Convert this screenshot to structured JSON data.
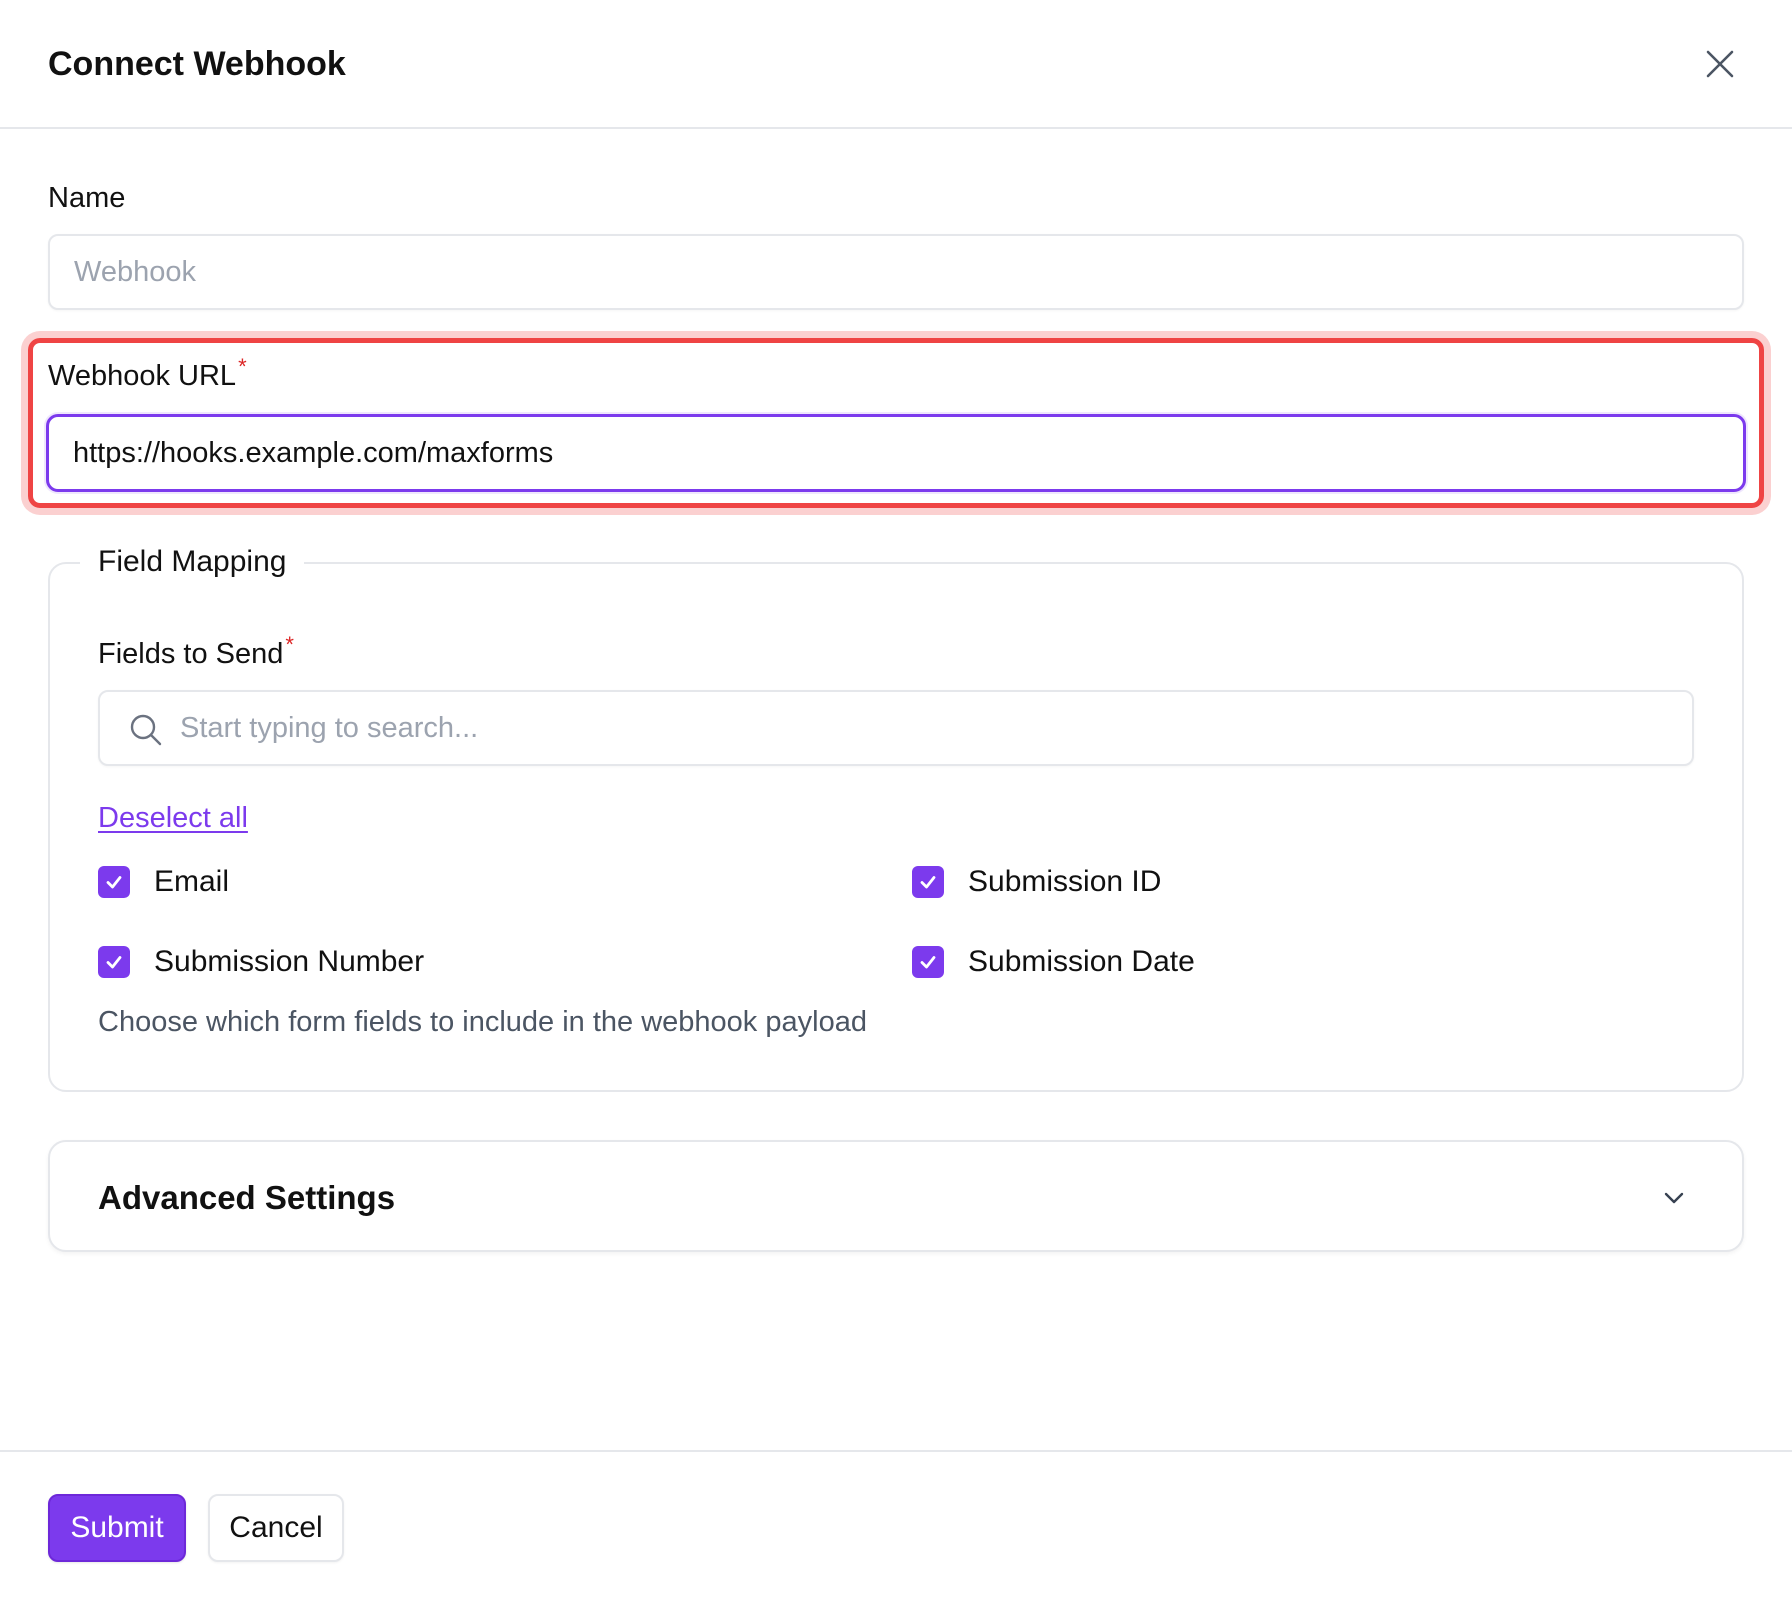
{
  "modal": {
    "title": "Connect Webhook"
  },
  "name_field": {
    "label": "Name",
    "placeholder": "Webhook",
    "value": ""
  },
  "url_field": {
    "label": "Webhook URL",
    "required_mark": "*",
    "value": "https://hooks.example.com/maxforms"
  },
  "field_mapping": {
    "legend": "Field Mapping",
    "fields_label": "Fields to Send",
    "required_mark": "*",
    "search_placeholder": "Start typing to search...",
    "deselect_all_label": "Deselect all",
    "options": [
      {
        "label": "Email",
        "checked": true
      },
      {
        "label": "Submission ID",
        "checked": true
      },
      {
        "label": "Submission Number",
        "checked": true
      },
      {
        "label": "Submission Date",
        "checked": true
      }
    ],
    "helper_text": "Choose which form fields to include in the webhook payload"
  },
  "advanced": {
    "title": "Advanced Settings",
    "expanded": false
  },
  "footer": {
    "submit_label": "Submit",
    "cancel_label": "Cancel"
  },
  "colors": {
    "accent": "#7c3aed",
    "highlight": "#ef4444",
    "required": "#dc2626",
    "border": "#e5e7eb"
  },
  "icons": {
    "close": "close-icon",
    "search": "search-icon",
    "check": "check-icon",
    "chevron": "chevron-down-icon"
  }
}
